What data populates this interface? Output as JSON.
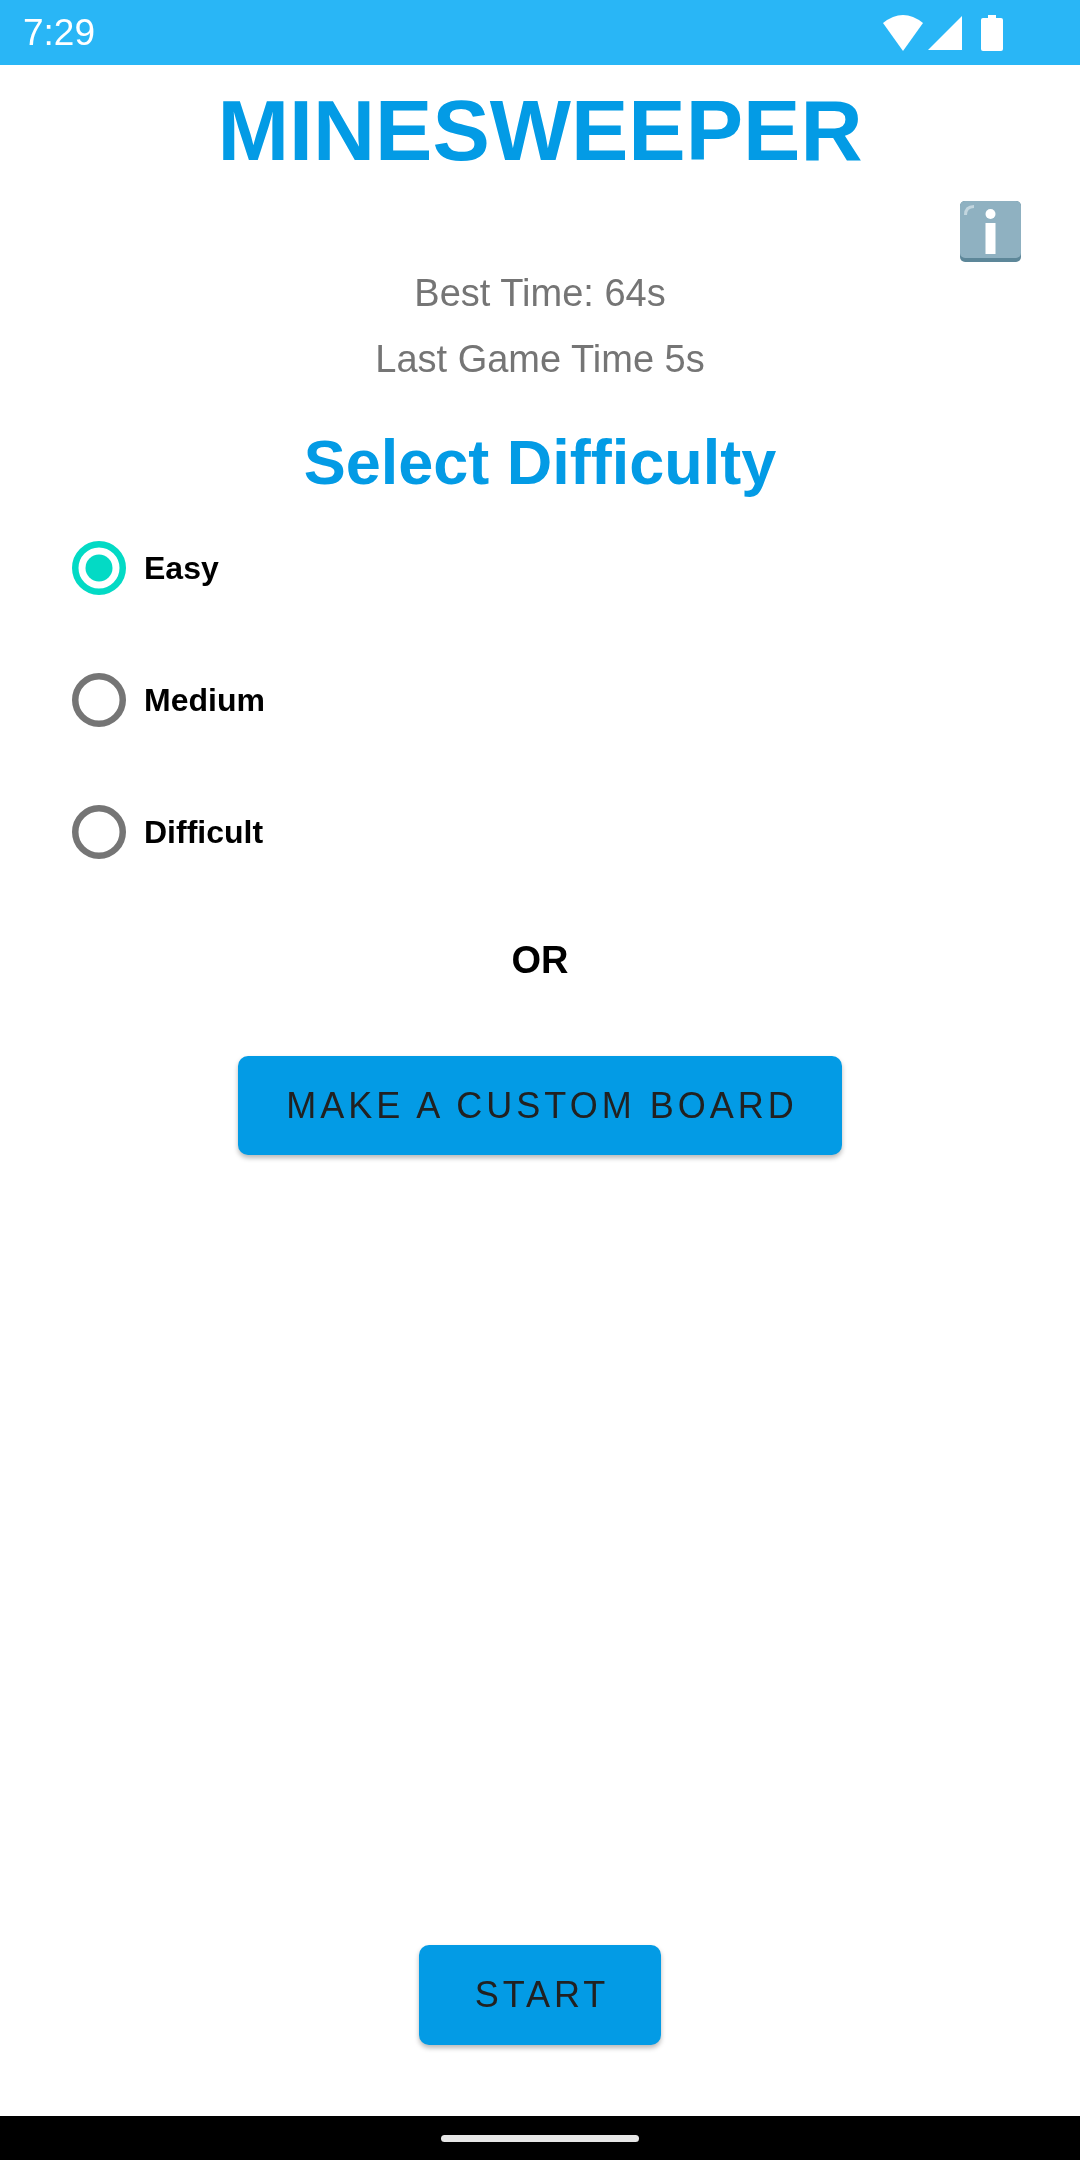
{
  "status_bar": {
    "time": "7:29"
  },
  "header": {
    "title": "MINESWEEPER",
    "best_time": "Best Time: 64s",
    "last_game_time": "Last Game Time 5s"
  },
  "difficulty": {
    "heading": "Select Difficulty",
    "options": [
      {
        "label": "Easy",
        "selected": true
      },
      {
        "label": "Medium",
        "selected": false
      },
      {
        "label": "Difficult",
        "selected": false
      }
    ]
  },
  "separator": "OR",
  "buttons": {
    "custom_board": "MAKE A CUSTOM BOARD",
    "start": "START"
  }
}
